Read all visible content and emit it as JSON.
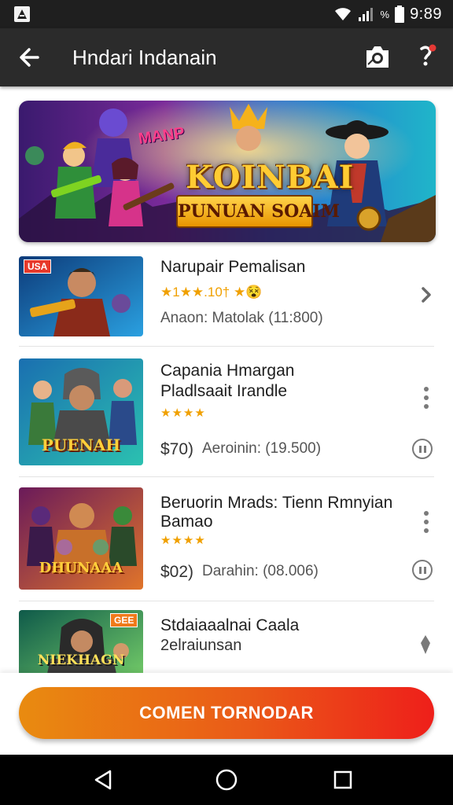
{
  "status_bar": {
    "time": "9:89",
    "battery_label": "%"
  },
  "header": {
    "title": "Hndari Indanain"
  },
  "hero": {
    "title": "KOINBAI",
    "subtitle": "PUNUAN SOAIM",
    "tag": "MANP"
  },
  "games": [
    {
      "title": "Narupair Pemalisan",
      "rating": "★1★★.10† ★😵",
      "meta": "Anaon: Matolak (11:800)",
      "badge": "USA"
    },
    {
      "title": "Capania Hmargan",
      "title_line2": "Pladlsaait Irandle",
      "stars": "★★★★",
      "price": "$70)",
      "meta": "Aeroinin: (19.500)",
      "caption": "PUENAH"
    },
    {
      "title": "Beruorin Mrads: Tienn Rmnyian",
      "title_line2": "Bamao",
      "stars": "★★★★",
      "price": "$02)",
      "meta": "Darahin: (08.006)",
      "caption": "DHUNAAA"
    },
    {
      "title": "Stdaiaaalnai Caala",
      "title_line2": "2elraiunsan",
      "caption": "NIEKHAGN",
      "badge": "GEE"
    }
  ],
  "cta": {
    "label": "COMEN TORNODAR"
  },
  "colors": {
    "app_bar": "#2b2b2b",
    "cta_start": "#e98b10",
    "cta_end": "#ee1f1a",
    "star": "#f0a000"
  }
}
